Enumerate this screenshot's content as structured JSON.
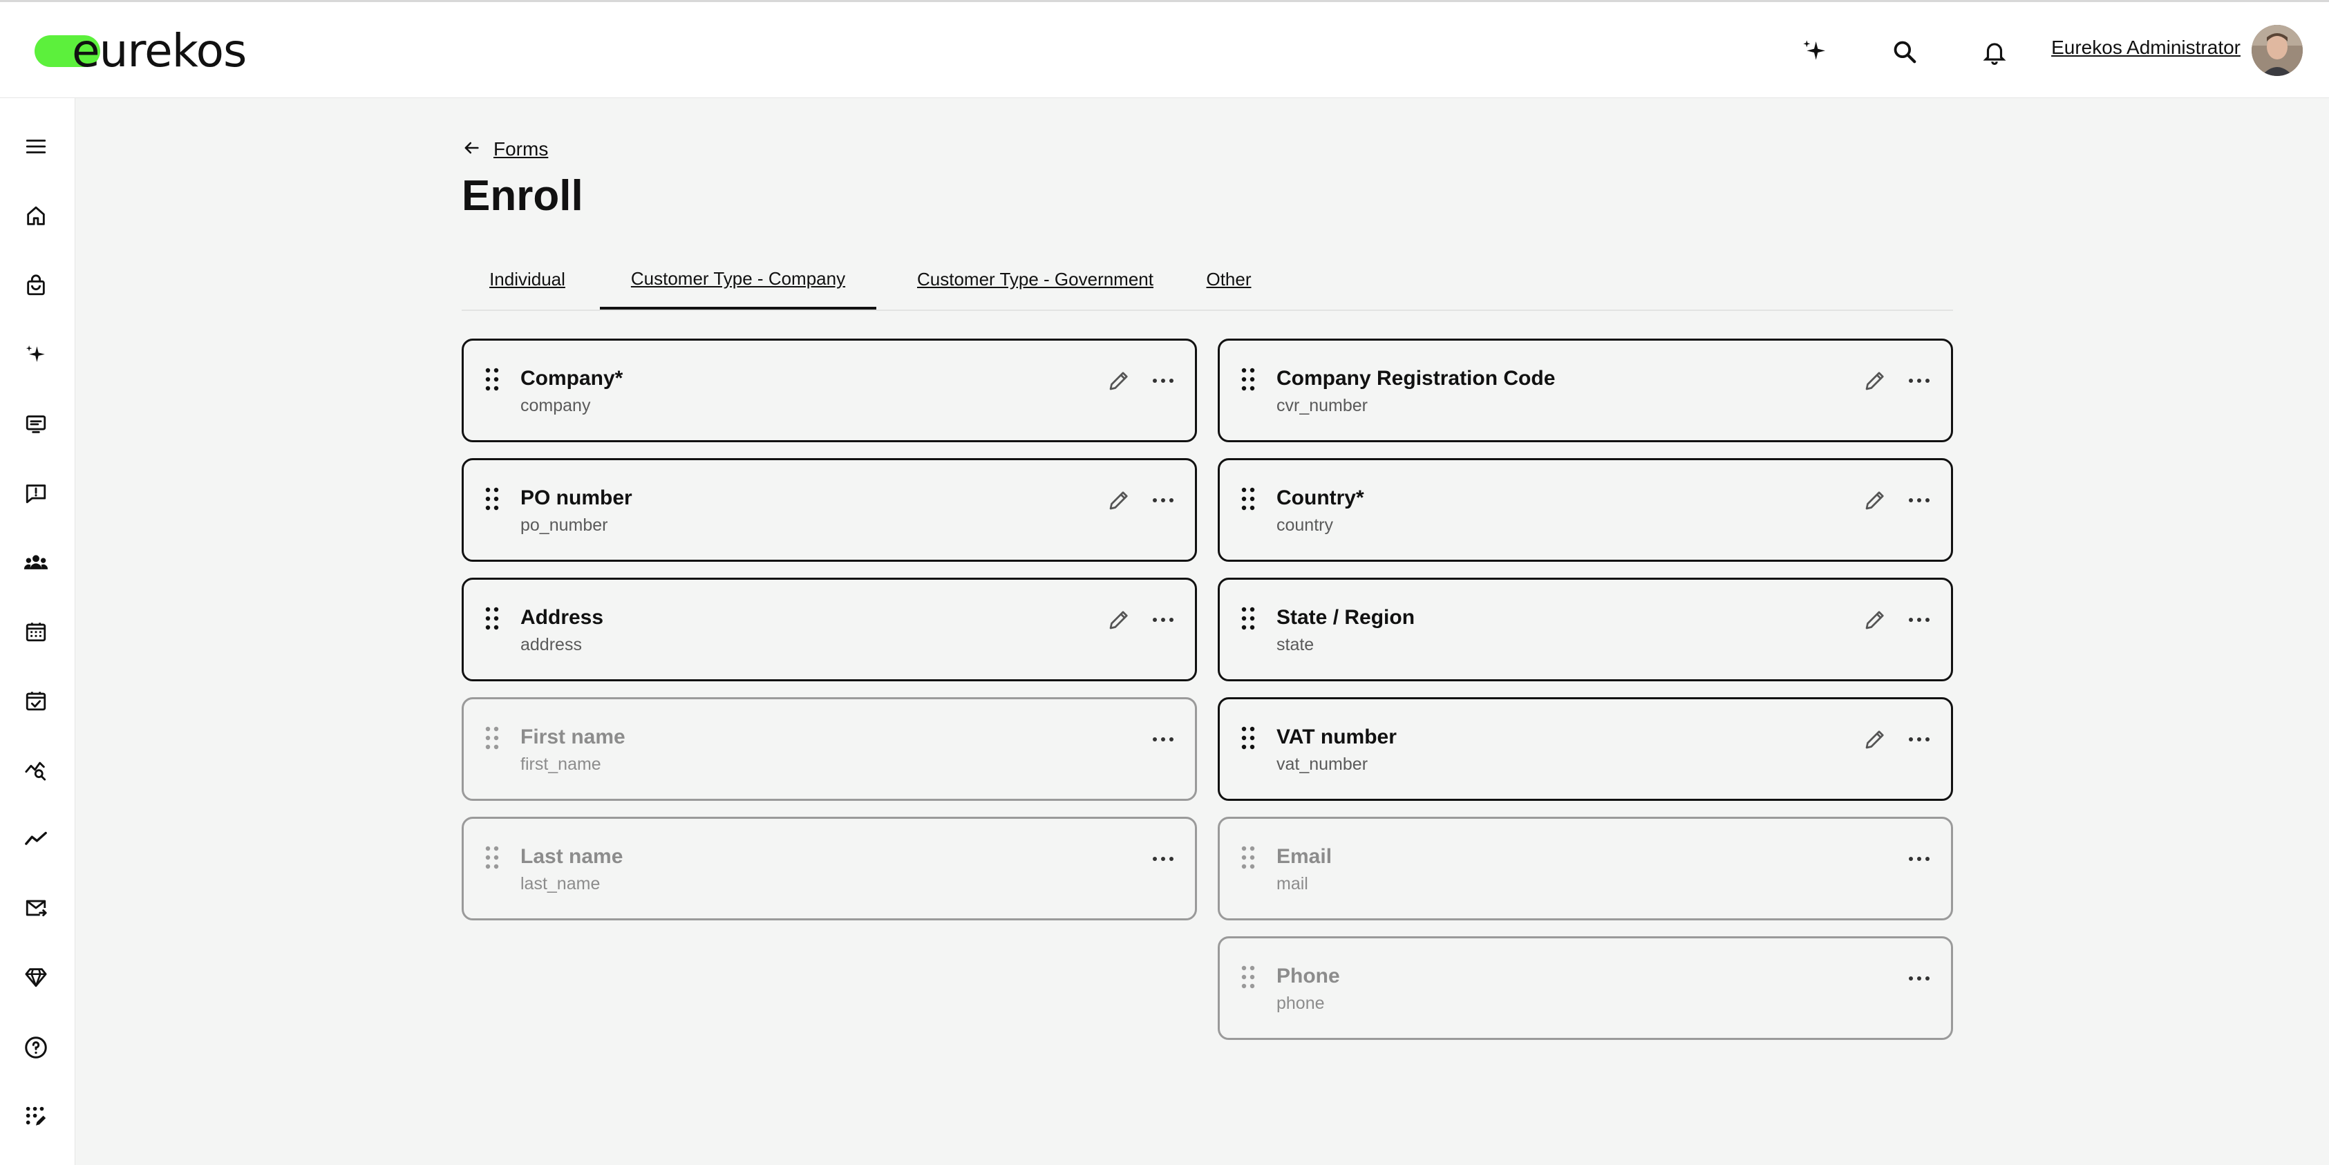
{
  "header": {
    "logo_text": "eurekos",
    "user_name": "Eurekos Administrator",
    "icons": [
      "sparkle-icon",
      "search-icon",
      "bell-icon"
    ]
  },
  "sidebar": {
    "icons": [
      "menu-icon",
      "home-icon",
      "shopping-bag-icon",
      "sparkle-icon",
      "presentation-icon",
      "message-alert-icon",
      "users-icon",
      "calendar-icon",
      "calendar-check-icon",
      "chart-search-icon",
      "trend-line-icon",
      "mail-forward-icon",
      "diamond-icon",
      "help-icon",
      "grid-edit-icon"
    ]
  },
  "breadcrumb": {
    "link": "Forms"
  },
  "page": {
    "title": "Enroll"
  },
  "tabs": [
    {
      "label": "Individual",
      "active": false
    },
    {
      "label": "Customer Type - Company",
      "active": true
    },
    {
      "label": "Customer Type - Government",
      "active": false
    },
    {
      "label": "Other",
      "active": false
    }
  ],
  "fields_left": [
    {
      "label": "Company*",
      "key": "company",
      "enabled": true
    },
    {
      "label": "PO number",
      "key": "po_number",
      "enabled": true
    },
    {
      "label": "Address",
      "key": "address",
      "enabled": true
    },
    {
      "label": "First name",
      "key": "first_name",
      "enabled": false
    },
    {
      "label": "Last name",
      "key": "last_name",
      "enabled": false
    }
  ],
  "fields_right": [
    {
      "label": "Company Registration Code",
      "key": "cvr_number",
      "enabled": true
    },
    {
      "label": "Country*",
      "key": "country",
      "enabled": true
    },
    {
      "label": "State / Region",
      "key": "state",
      "enabled": true
    },
    {
      "label": "VAT number",
      "key": "vat_number",
      "enabled": true
    },
    {
      "label": "Email",
      "key": "mail",
      "enabled": false
    },
    {
      "label": "Phone",
      "key": "phone",
      "enabled": false
    }
  ],
  "colors": {
    "brand": "#5cf03c",
    "background": "#f4f5f4",
    "border_active": "#111111",
    "border_disabled": "#9a9a9a"
  }
}
